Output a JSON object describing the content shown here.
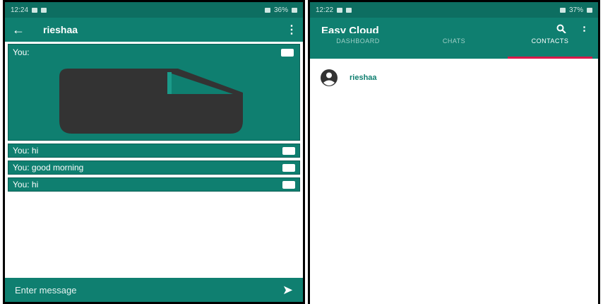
{
  "left_screen": {
    "status": {
      "time": "12:24",
      "right": "36%"
    },
    "app_bar": {
      "back": "←",
      "title": "rieshaa",
      "menu": "⋮"
    },
    "messages": [
      {
        "type": "image",
        "label": "You:"
      },
      {
        "type": "text",
        "label": "You: hi"
      },
      {
        "type": "text",
        "label": "You: good morning"
      },
      {
        "type": "text",
        "label": "You: hi"
      }
    ],
    "input": {
      "placeholder": "Enter message",
      "send_icon": "send-icon"
    }
  },
  "right_screen": {
    "status": {
      "time": "12:22",
      "right": "37%"
    },
    "app_bar": {
      "title": "Easy Cloud",
      "search_icon": "search-icon",
      "menu": "⋮"
    },
    "tabs": [
      {
        "label": "DASHBOARD",
        "active": false
      },
      {
        "label": "CHATS",
        "active": false
      },
      {
        "label": "CONTACTS",
        "active": true
      }
    ],
    "contacts": [
      {
        "name": "rieshaa",
        "icon": "account-circle-icon"
      }
    ]
  },
  "colors": {
    "primary": "#0f7f70",
    "status": "#0d6e61",
    "accent": "#d9184a"
  }
}
